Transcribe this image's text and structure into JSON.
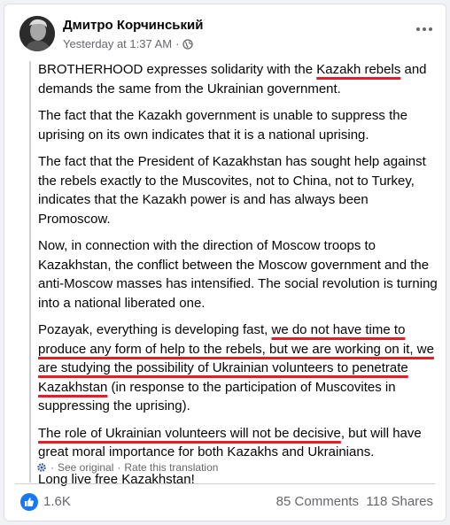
{
  "post": {
    "author": "Дмитро Корчинський",
    "timestamp": "Yesterday at 1:37 AM",
    "separator": "·",
    "privacy_icon": "globe-icon",
    "paragraphs": {
      "p1_a": "BROTHERHOOD expresses solidarity with the ",
      "p1_u": "Kazakh rebels",
      "p1_b": " and demands the same from the Ukrainian government.",
      "p2": "The fact that the Kazakh government is unable to suppress the uprising on its own indicates that it is a national uprising.",
      "p3": "The fact that the President of Kazakhstan has sought help against the rebels exactly to the Muscovites, not to China, not to Turkey, indicates that the Kazakh power is and has always been Promoscow.",
      "p4": "Now, in connection with the direction of Moscow troops to Kazakhstan, the conflict between the Moscow government and the anti-Moscow masses has intensified. The social revolution is turning into a national liberated one.",
      "p5_a": "Pozayak, everything is developing fast, ",
      "p5_u": "we do not have time to produce any form of help to the rebels, but we are working on it, we are studying the possibility of Ukrainian volunteers to penetrate Kazakhstan",
      "p5_b": " (in response to the participation of Muscovites in suppressing the uprising).",
      "p6_u": "The role of Ukrainian volunteers will not be decisive",
      "p6_b": ", but will have great moral importance for both Kazakhs and Ukrainians.",
      "p7": "Long live free Kazakhstan!"
    },
    "translation": {
      "see_original": "See original",
      "separator": "·",
      "rate": "Rate this translation"
    },
    "stats": {
      "reactions": "1.6K",
      "comments": "85 Comments",
      "shares": "118 Shares"
    }
  },
  "colors": {
    "accent": "#1877f2",
    "highlight_underline": "#e41e26",
    "secondary_text": "#65676b"
  }
}
